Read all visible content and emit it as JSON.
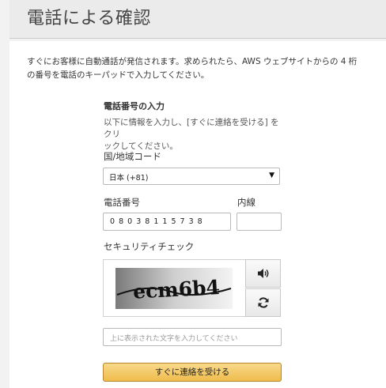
{
  "page": {
    "title": "電話による確認"
  },
  "intro": {
    "line1": "すぐにお客様に自動通話が発信されます。求められたら、AWS ウェブサイトからの 4 桁",
    "line2": "の番号を電話のキーパッドで入力してください。"
  },
  "section": {
    "title": "電話番号の入力",
    "desc_line1": "以下に情報を入力し、[すぐに連絡を受ける] をクリ",
    "desc_line2": "ックしてください。"
  },
  "country": {
    "label": "国/地域コード",
    "selected": "日本 (+81)"
  },
  "phone": {
    "label": "電話番号",
    "value": "0 8 0 3 8 1 1 5 7 3 8"
  },
  "extension": {
    "label": "内線",
    "value": ""
  },
  "security": {
    "label": "セキュリティチェック",
    "captcha_text": "ecm6b4",
    "input_placeholder": "上に表示された文字を入力してください"
  },
  "icons": {
    "audio": "speaker-icon",
    "refresh": "refresh-icon"
  },
  "submit": {
    "label": "すぐに連絡を受ける"
  },
  "colors": {
    "button_top": "#f7d98a",
    "button_bottom": "#f0bc4c",
    "button_border": "#b7862a"
  }
}
